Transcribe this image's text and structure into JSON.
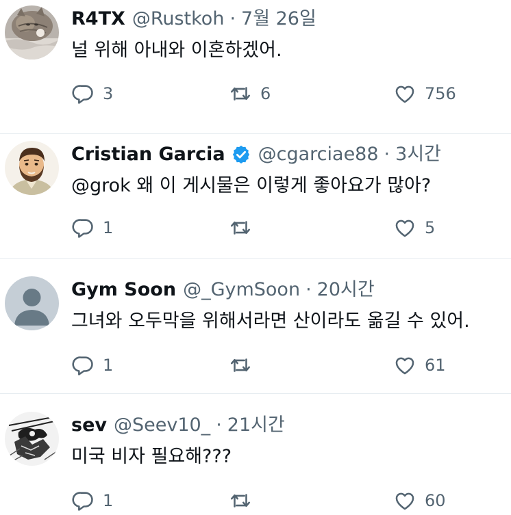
{
  "tweets": [
    {
      "display_name": "R4TX",
      "handle": "@Rustkoh",
      "separator": "·",
      "time": "7월 26일",
      "verified": false,
      "avatar": "cat-photo",
      "text": "널 위해 아내와 이혼하겠어.",
      "replies": "3",
      "retweets": "6",
      "likes": "756"
    },
    {
      "display_name": "Cristian Garcia",
      "handle": "@cgarciae88",
      "separator": "·",
      "time": "3시간",
      "verified": true,
      "avatar": "bearded-man-illustration",
      "text": "@grok 왜 이 게시물은 이렇게 좋아요가 많아?",
      "replies": "1",
      "retweets": "",
      "likes": "5"
    },
    {
      "display_name": "Gym Soon",
      "handle": "@_GymSoon",
      "separator": "·",
      "time": "20시간",
      "verified": false,
      "avatar": "default-profile",
      "text": "그녀와 오두막을 위해서라면 산이라도 옮길 수 있어.",
      "replies": "1",
      "retweets": "",
      "likes": "61"
    },
    {
      "display_name": "sev",
      "handle": "@Seev10_",
      "separator": "·",
      "time": "21시간",
      "verified": false,
      "avatar": "manga-sketch",
      "text": "미국 비자 필요해???",
      "replies": "1",
      "retweets": "",
      "likes": "60"
    }
  ],
  "icons": {
    "reply": "reply-icon",
    "retweet": "retweet-icon",
    "like": "like-icon",
    "verified": "verified-badge-icon"
  },
  "colors": {
    "text": "#0f1419",
    "muted": "#536471",
    "verified": "#1d9bf0",
    "divider": "#e6ecf0"
  }
}
